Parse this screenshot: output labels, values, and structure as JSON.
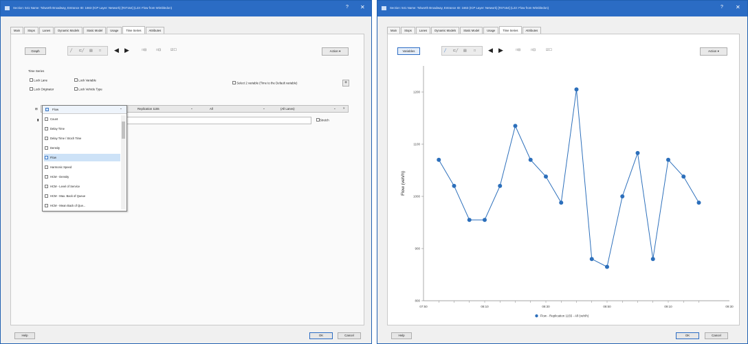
{
  "left": {
    "title": "Section: 541 Name: Tolworth Broadway, Entrance ID: 1663 (ICP Layer: Network) [#37164] (L23: Flow from Wimbledon)",
    "tabs": [
      "Main",
      "Stops",
      "Lanes",
      "Dynamic Models",
      "Static Model",
      "Usage",
      "Time Series",
      "Attributes"
    ],
    "selected_tab": "Time Series",
    "toolbar": {
      "graph_label": "Graph",
      "action_label": "Action"
    },
    "time_series_label": "Time Series",
    "checkboxes": [
      "Lock Lane",
      "Lock Variable",
      "Lock Originator",
      "Lock Vehicle Type"
    ],
    "select_variable_label": "Select 2 variable (Time to the Default variable)",
    "series_row": {
      "variable": "Flow",
      "originator": "Replication 1155",
      "vehicle": "All",
      "lane": "(All Lanes)"
    },
    "dropdown_items": [
      "Count",
      "Delay Time",
      "Delay Time / Stoch Time",
      "Density",
      "Flow",
      "Harmonic Speed",
      "HCM - Density",
      "HCM - Level of Service",
      "HCM - Max. Back of Queue",
      "HCM - Mean Back of Que..."
    ],
    "dropdown_selected": "Flow",
    "stretch_label": "Stretch",
    "help_label": "Help",
    "ok_label": "OK",
    "cancel_label": "Cancel"
  },
  "right": {
    "title": "Section: 541 Name: Tolworth Broadway, Entrance ID: 1663 (ICP Layer: Network) [#37164] (L23: Flow from Wimbledon)",
    "tabs": [
      "Main",
      "Stops",
      "Lanes",
      "Dynamic Models",
      "Static Model",
      "Usage",
      "Time Series",
      "Attributes"
    ],
    "selected_tab": "Time Series",
    "toolbar": {
      "variables_label": "Variables",
      "action_label": "Action"
    },
    "help_label": "Help",
    "ok_label": "OK",
    "cancel_label": "Cancel"
  },
  "chart_data": {
    "type": "line",
    "ylabel": "Flow (veh/h)",
    "xlabel": "",
    "x": [
      "07:55",
      "08:00",
      "08:05",
      "08:10",
      "08:15",
      "08:20",
      "08:25",
      "08:30",
      "08:35",
      "08:40",
      "08:45",
      "08:50",
      "08:55",
      "09:00",
      "09:05",
      "09:10",
      "09:15",
      "09:20"
    ],
    "series": [
      {
        "name": "Flow - Replication 1155 - All (veh/h)",
        "color": "#2c6fbb",
        "values": [
          1070,
          1020,
          955,
          955,
          1020,
          1135,
          1070,
          1038,
          988,
          1205,
          880,
          865,
          1000,
          1083,
          880,
          1070,
          1038,
          988
        ]
      }
    ],
    "ylim": [
      800,
      1250
    ],
    "yticks": [
      "800",
      "900",
      "1000",
      "1100",
      "1200"
    ],
    "xticks": [
      "07:50",
      "08:10",
      "08:30",
      "08:50",
      "09:10",
      "09:30"
    ],
    "grid": false,
    "legend_placement": "bottom-center"
  }
}
